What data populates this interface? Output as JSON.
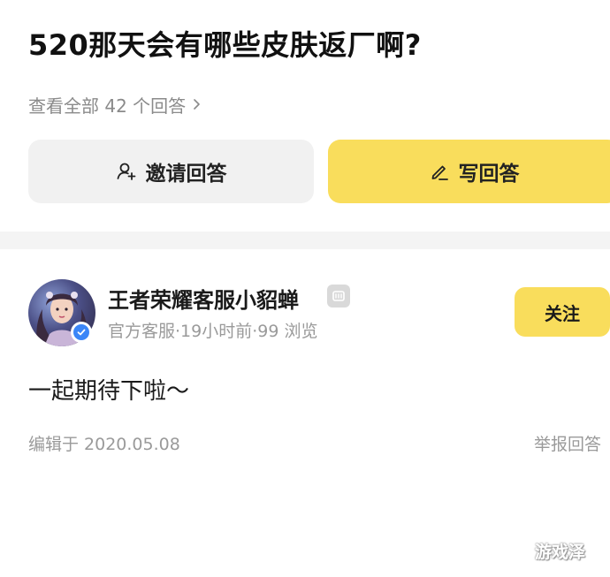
{
  "question": {
    "title": "520那天会有哪些皮肤返厂啊?",
    "view_all": "查看全部 42 个回答"
  },
  "actions": {
    "invite_label": "邀请回答",
    "write_label": "写回答",
    "icons": {
      "invite": "person-plus-icon",
      "write": "pencil-icon"
    }
  },
  "answer": {
    "author": "王者荣耀客服小貂蝉",
    "meta": "官方客服·19小时前·99 浏览",
    "follow_label": "关注",
    "content": "一起期待下啦～",
    "edit_time": "编辑于 2020.05.08",
    "report_label": "举报回答"
  },
  "watermark": "游戏泽",
  "colors": {
    "accent_yellow": "#f9dd5c",
    "verified_blue": "#3b86f7",
    "muted_text": "#9a9a9a"
  }
}
